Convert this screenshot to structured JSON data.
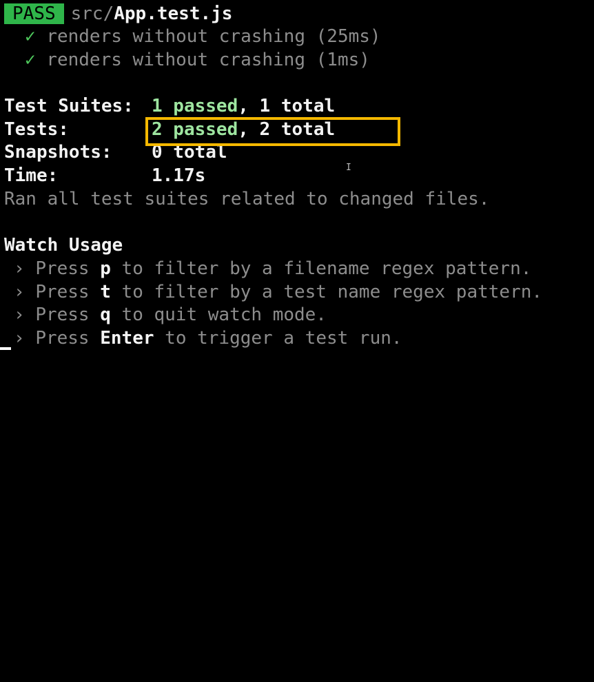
{
  "header": {
    "status_badge": "PASS",
    "file_dir": "src/",
    "file_name": "App.test.js"
  },
  "tests": [
    {
      "check": "✓",
      "text": "renders without crashing (25ms)"
    },
    {
      "check": "✓",
      "text": "renders without crashing (1ms)"
    }
  ],
  "summary": {
    "suites_label": "Test Suites:",
    "suites_passed": "1 passed",
    "suites_sep": ",",
    "suites_total": "1 total",
    "tests_label": "Tests:",
    "tests_passed": "2 passed",
    "tests_sep": ",",
    "tests_total": "2 total",
    "snapshots_label": "Snapshots:",
    "snapshots_value": "0 total",
    "time_label": "Time:",
    "time_value": "1.17s",
    "ran_all": "Ran all test suites related to changed files."
  },
  "watch": {
    "title": "Watch Usage",
    "items": [
      {
        "prompt": "›",
        "pre": "Press ",
        "key": "p",
        "post": " to filter by a filename regex pattern."
      },
      {
        "prompt": "›",
        "pre": "Press ",
        "key": "t",
        "post": " to filter by a test name regex pattern."
      },
      {
        "prompt": "›",
        "pre": "Press ",
        "key": "q",
        "post": " to quit watch mode."
      },
      {
        "prompt": "›",
        "pre": "Press ",
        "key": "Enter",
        "post": " to trigger a test run."
      }
    ]
  },
  "colors": {
    "badge_bg": "#2fb54a",
    "check": "#4ec85c",
    "passed": "#9ee5a0",
    "highlight": "#f5b800",
    "dim_text": "#8d8d8d"
  }
}
